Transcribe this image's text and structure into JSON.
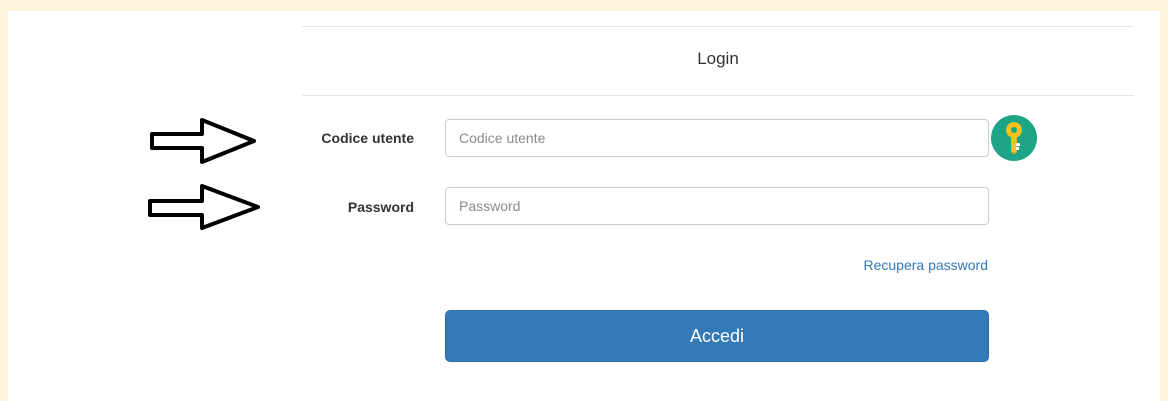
{
  "form": {
    "title": "Login",
    "username": {
      "label": "Codice utente",
      "placeholder": "Codice utente",
      "value": ""
    },
    "password": {
      "label": "Password",
      "placeholder": "Password",
      "value": ""
    },
    "recover_link": "Recupera password",
    "submit_label": "Accedi"
  },
  "icons": {
    "key_button": "key-icon",
    "annotation_arrows": [
      "arrow-right-icon",
      "arrow-right-icon"
    ]
  },
  "colors": {
    "page_background": "#fff4d9",
    "primary_button": "#337ab7",
    "link": "#337ab7",
    "key_circle": "#1ea486",
    "key_fill": "#f7c31a"
  }
}
